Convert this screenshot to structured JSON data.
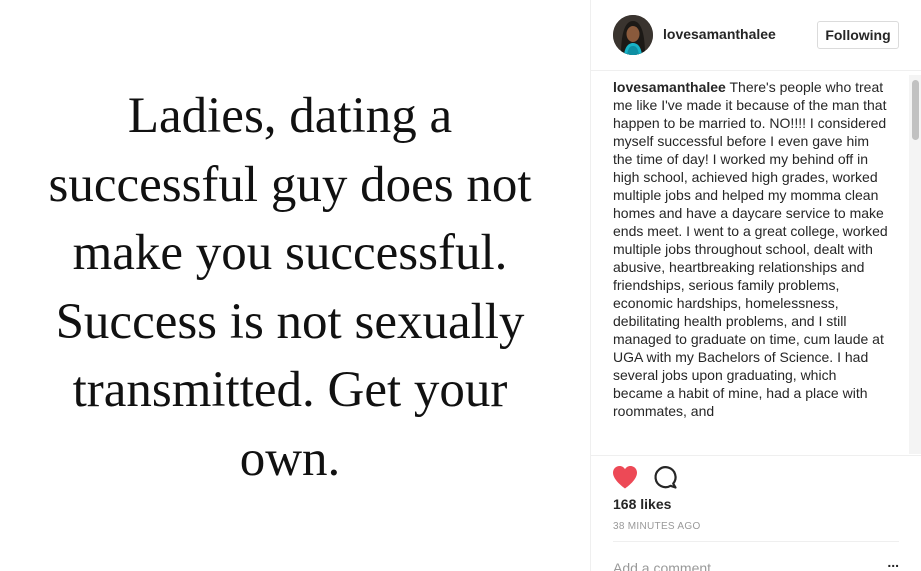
{
  "media": {
    "quote_lines": [
      "Ladies, dating a",
      "successful guy does not",
      "make you successful.",
      "Success is not sexually",
      "transmitted. Get your",
      "own."
    ]
  },
  "header": {
    "username": "lovesamanthalee",
    "follow_label": "Following",
    "avatar_icon": "profile-photo"
  },
  "caption": {
    "username": "lovesamanthalee",
    "text": "There's people who treat me like I've made it because of the man that happen to be married to. NO!!!! I considered myself successful before I even gave him the time of day! I worked my behind off in high school, achieved high grades, worked multiple jobs and helped my momma clean homes and have a daycare service to make ends meet. I went to a great college, worked multiple jobs throughout school, dealt with abusive, heartbreaking relationships and friendships, serious family problems, economic hardships, homelessness, debilitating health problems, and I still managed to graduate on time, cum laude at UGA with my Bachelors of Science. I had several jobs upon graduating, which became a habit of mine, had a place with roommates, and"
  },
  "actions": {
    "like_icon": "heart-icon",
    "like_color": "#ed4956",
    "comment_icon": "speech-bubble-icon"
  },
  "likes": "168 likes",
  "timestamp": "38 MINUTES AGO",
  "comment": {
    "placeholder": "Add a comment...",
    "more_label": "..."
  }
}
